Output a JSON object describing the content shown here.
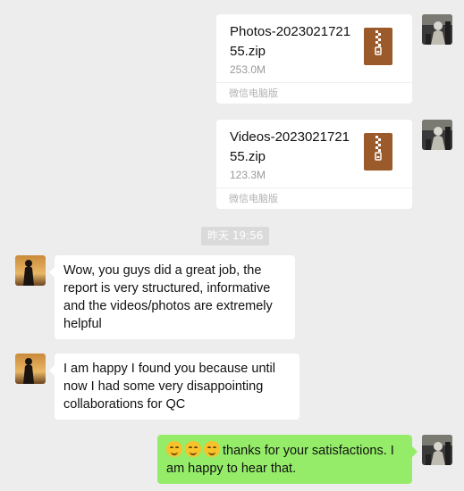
{
  "messages": {
    "file1": {
      "name": "Photos-202302172155.zip",
      "size": "253.0M",
      "source": "微信电脑版"
    },
    "file2": {
      "name": "Videos-202302172155.zip",
      "size": "123.3M",
      "source": "微信电脑版"
    },
    "timestamp": "昨天 19:56",
    "msg1": "Wow, you guys did a great job, the report is very structured, informative and the videos/photos are extremely helpful",
    "msg2": "I am happy I found you because until now I had some very disappointing collaborations for QC",
    "reply": {
      "emoji": "smile-emoji",
      "text": "thanks for your satisfactions. I am happy to hear that."
    }
  },
  "colors": {
    "background": "#ededed",
    "incoming_bubble": "#ffffff",
    "outgoing_bubble": "#95ec69",
    "zip_icon": "#9b5a2a"
  },
  "icons": {
    "zip": "zip-file-icon"
  }
}
